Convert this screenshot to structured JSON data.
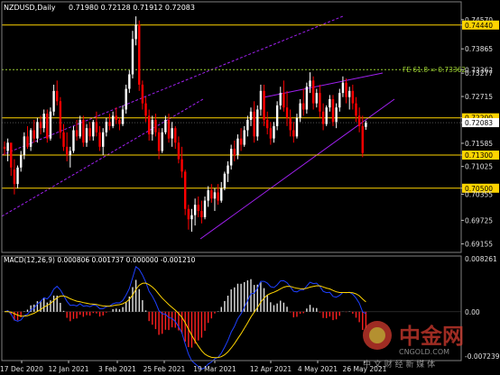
{
  "header": {
    "symbol": "NZDUSD,Daily",
    "ohlc": "0.71980 0.72128 0.71912 0.72083"
  },
  "fib_label": "FE 61.8 = 0.73362",
  "macd_label": "MACD(12,26,9) 0.000806 0.001737 0.000000 -0.001210",
  "watermark": {
    "brand": "中金网",
    "site": "CNGOLD.COM",
    "tagline": "中 文 财 经 新 媒 体"
  },
  "colors": {
    "background": "#000000",
    "bull": "#ffffff",
    "bear": "#ff0000",
    "level": "#ffd400",
    "channel": "#a020f0",
    "fib": "#9acd32",
    "signal": "#ffd400",
    "macd_line": "#1e40ff"
  },
  "chart_data": {
    "type": "candlestick",
    "y_ticks": [
      "0.74570",
      "0.74440",
      "0.73865",
      "0.73362",
      "0.73277",
      "0.72715",
      "0.72200",
      "0.72083",
      "0.71585",
      "0.71300",
      "0.71025",
      "0.70500",
      "0.70355",
      "0.69725",
      "0.69155"
    ],
    "y_highlighted": [
      "0.74440",
      "0.72200",
      "0.72083",
      "0.71300",
      "0.70500"
    ],
    "x_ticks": [
      "17 Dec 2020",
      "12 Jan 2021",
      "3 Feb 2021",
      "25 Feb 2021",
      "19 Mar 2021",
      "12 Apr 2021",
      "4 May 2021",
      "26 May 2021"
    ],
    "levels": [
      0.7444,
      0.722,
      0.713,
      0.705
    ],
    "fib_level": 0.73362,
    "last_price": 0.72083,
    "macd_ticks": [
      "0.008261",
      "0.00",
      "-0.007239"
    ],
    "ylim": [
      0.6895,
      0.7474
    ],
    "candles": [
      [
        0.715,
        0.7163,
        0.713,
        0.7145
      ],
      [
        0.714,
        0.717,
        0.7115,
        0.716
      ],
      [
        0.716,
        0.7145,
        0.708,
        0.71
      ],
      [
        0.7095,
        0.712,
        0.7035,
        0.706
      ],
      [
        0.706,
        0.7105,
        0.705,
        0.71
      ],
      [
        0.71,
        0.714,
        0.709,
        0.713
      ],
      [
        0.713,
        0.7185,
        0.712,
        0.7175
      ],
      [
        0.7175,
        0.72,
        0.7145,
        0.715
      ],
      [
        0.715,
        0.7195,
        0.714,
        0.719
      ],
      [
        0.719,
        0.7215,
        0.716,
        0.717
      ],
      [
        0.717,
        0.722,
        0.716,
        0.721
      ],
      [
        0.721,
        0.7225,
        0.718,
        0.7195
      ],
      [
        0.7195,
        0.724,
        0.7185,
        0.723
      ],
      [
        0.723,
        0.724,
        0.716,
        0.717
      ],
      [
        0.717,
        0.7245,
        0.7165,
        0.7235
      ],
      [
        0.7235,
        0.73,
        0.7225,
        0.7285
      ],
      [
        0.7285,
        0.731,
        0.725,
        0.726
      ],
      [
        0.726,
        0.727,
        0.717,
        0.7185
      ],
      [
        0.7185,
        0.7205,
        0.714,
        0.715
      ],
      [
        0.715,
        0.7185,
        0.7115,
        0.713
      ],
      [
        0.713,
        0.715,
        0.71,
        0.714
      ],
      [
        0.714,
        0.72,
        0.7135,
        0.719
      ],
      [
        0.719,
        0.7215,
        0.7165,
        0.7175
      ],
      [
        0.7175,
        0.7225,
        0.717,
        0.7215
      ],
      [
        0.7215,
        0.7225,
        0.715,
        0.716
      ],
      [
        0.716,
        0.7205,
        0.715,
        0.7195
      ],
      [
        0.7195,
        0.721,
        0.7165,
        0.7175
      ],
      [
        0.7175,
        0.7215,
        0.7165,
        0.721
      ],
      [
        0.721,
        0.7235,
        0.7175,
        0.7185
      ],
      [
        0.7185,
        0.72,
        0.714,
        0.715
      ],
      [
        0.715,
        0.7195,
        0.713,
        0.7185
      ],
      [
        0.7185,
        0.722,
        0.7175,
        0.721
      ],
      [
        0.721,
        0.723,
        0.719,
        0.72
      ],
      [
        0.72,
        0.7235,
        0.7195,
        0.7225
      ],
      [
        0.7225,
        0.7245,
        0.7205,
        0.7215
      ],
      [
        0.7215,
        0.722,
        0.719,
        0.7205
      ],
      [
        0.7205,
        0.725,
        0.72,
        0.724
      ],
      [
        0.724,
        0.73,
        0.723,
        0.729
      ],
      [
        0.729,
        0.7335,
        0.728,
        0.7325
      ],
      [
        0.7325,
        0.743,
        0.7315,
        0.741
      ],
      [
        0.741,
        0.7465,
        0.7395,
        0.7445
      ],
      [
        0.7445,
        0.7455,
        0.7285,
        0.73
      ],
      [
        0.73,
        0.731,
        0.724,
        0.7255
      ],
      [
        0.7255,
        0.727,
        0.721,
        0.7225
      ],
      [
        0.7225,
        0.724,
        0.7165,
        0.718
      ],
      [
        0.718,
        0.7225,
        0.7165,
        0.7215
      ],
      [
        0.7215,
        0.723,
        0.7175,
        0.7185
      ],
      [
        0.7185,
        0.7195,
        0.712,
        0.714
      ],
      [
        0.714,
        0.7195,
        0.7135,
        0.7185
      ],
      [
        0.7185,
        0.7225,
        0.718,
        0.7215
      ],
      [
        0.7215,
        0.723,
        0.716,
        0.717
      ],
      [
        0.717,
        0.721,
        0.715,
        0.7195
      ],
      [
        0.7195,
        0.72,
        0.7145,
        0.716
      ],
      [
        0.716,
        0.7175,
        0.711,
        0.712
      ],
      [
        0.712,
        0.715,
        0.7075,
        0.709
      ],
      [
        0.709,
        0.7095,
        0.6985,
        0.7
      ],
      [
        0.7,
        0.701,
        0.695,
        0.6975
      ],
      [
        0.6975,
        0.7,
        0.6945,
        0.6985
      ],
      [
        0.6985,
        0.7025,
        0.696,
        0.701
      ],
      [
        0.701,
        0.703,
        0.698,
        0.6995
      ],
      [
        0.6995,
        0.702,
        0.6965,
        0.698
      ],
      [
        0.698,
        0.703,
        0.6975,
        0.702
      ],
      [
        0.702,
        0.7055,
        0.7005,
        0.7045
      ],
      [
        0.7045,
        0.706,
        0.7015,
        0.7025
      ],
      [
        0.7025,
        0.705,
        0.6995,
        0.704
      ],
      [
        0.704,
        0.706,
        0.701,
        0.702
      ],
      [
        0.702,
        0.7065,
        0.7015,
        0.705
      ],
      [
        0.705,
        0.709,
        0.7045,
        0.7085
      ],
      [
        0.7085,
        0.7115,
        0.7065,
        0.7105
      ],
      [
        0.7105,
        0.7155,
        0.7095,
        0.7145
      ],
      [
        0.7145,
        0.7165,
        0.7115,
        0.713
      ],
      [
        0.713,
        0.718,
        0.712,
        0.717
      ],
      [
        0.717,
        0.7195,
        0.714,
        0.7155
      ],
      [
        0.7155,
        0.72,
        0.715,
        0.719
      ],
      [
        0.719,
        0.7225,
        0.7175,
        0.7215
      ],
      [
        0.7215,
        0.7245,
        0.72,
        0.7235
      ],
      [
        0.7235,
        0.726,
        0.716,
        0.7175
      ],
      [
        0.7175,
        0.725,
        0.7165,
        0.724
      ],
      [
        0.724,
        0.73,
        0.7225,
        0.7285
      ],
      [
        0.7285,
        0.73,
        0.72,
        0.7215
      ],
      [
        0.7215,
        0.7235,
        0.718,
        0.7195
      ],
      [
        0.7195,
        0.721,
        0.7155,
        0.717
      ],
      [
        0.717,
        0.721,
        0.716,
        0.72
      ],
      [
        0.72,
        0.726,
        0.719,
        0.725
      ],
      [
        0.725,
        0.7295,
        0.724,
        0.728
      ],
      [
        0.728,
        0.731,
        0.7235,
        0.7245
      ],
      [
        0.7245,
        0.7285,
        0.72,
        0.722
      ],
      [
        0.722,
        0.724,
        0.7175,
        0.719
      ],
      [
        0.719,
        0.721,
        0.716,
        0.7175
      ],
      [
        0.7175,
        0.723,
        0.717,
        0.722
      ],
      [
        0.722,
        0.7265,
        0.721,
        0.7255
      ],
      [
        0.7255,
        0.729,
        0.7225,
        0.724
      ],
      [
        0.724,
        0.7305,
        0.723,
        0.7295
      ],
      [
        0.7295,
        0.733,
        0.728,
        0.731
      ],
      [
        0.731,
        0.732,
        0.724,
        0.7255
      ],
      [
        0.7255,
        0.729,
        0.7245,
        0.728
      ],
      [
        0.728,
        0.73,
        0.722,
        0.7235
      ],
      [
        0.7235,
        0.7255,
        0.719,
        0.7205
      ],
      [
        0.7205,
        0.725,
        0.72,
        0.7245
      ],
      [
        0.7245,
        0.7275,
        0.7235,
        0.7265
      ],
      [
        0.7265,
        0.7275,
        0.72,
        0.721
      ],
      [
        0.721,
        0.7255,
        0.7195,
        0.7245
      ],
      [
        0.7245,
        0.729,
        0.7235,
        0.728
      ],
      [
        0.728,
        0.732,
        0.727,
        0.7305
      ],
      [
        0.7305,
        0.7315,
        0.7255,
        0.727
      ],
      [
        0.727,
        0.7295,
        0.724,
        0.7285
      ],
      [
        0.7285,
        0.73,
        0.724,
        0.7255
      ],
      [
        0.7255,
        0.727,
        0.721,
        0.7225
      ],
      [
        0.7225,
        0.7245,
        0.7185,
        0.72
      ],
      [
        0.72,
        0.7225,
        0.7125,
        0.7135
      ],
      [
        0.7198,
        0.7213,
        0.7191,
        0.7208
      ]
    ]
  }
}
